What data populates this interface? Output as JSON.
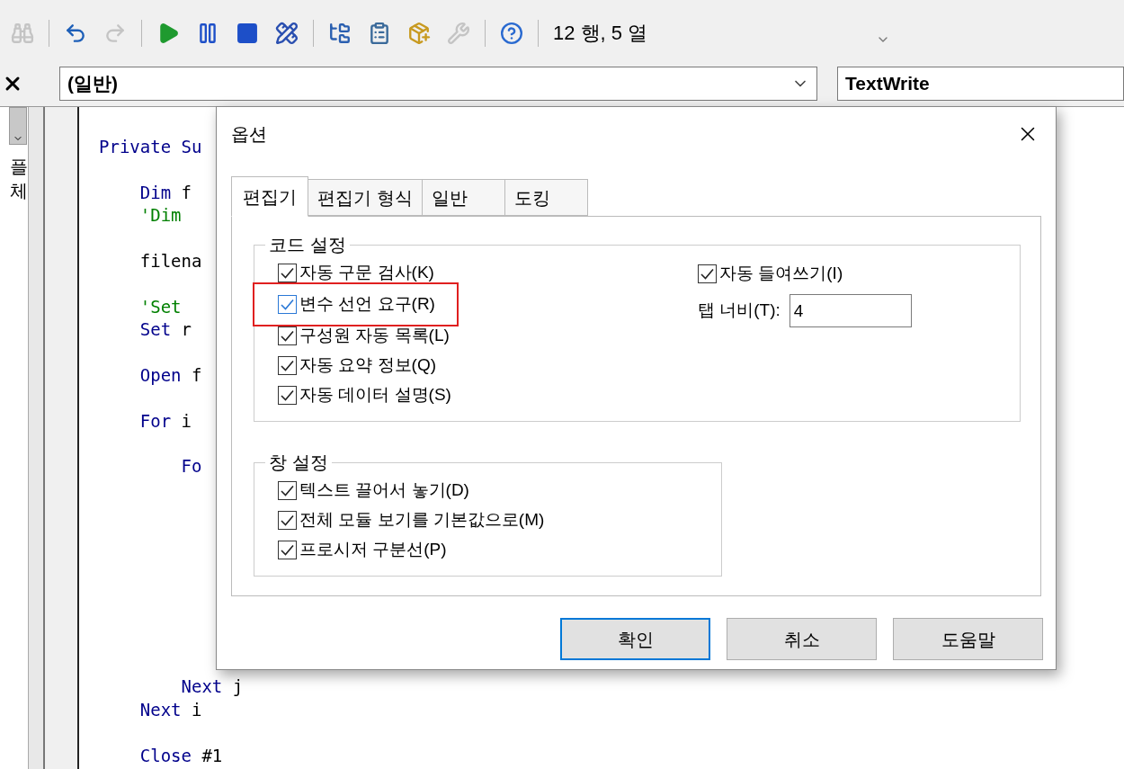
{
  "toolbar": {
    "buttons": [
      {
        "kind": "find",
        "disabled": true
      },
      {
        "kind": "separator"
      },
      {
        "kind": "undo",
        "disabled": false
      },
      {
        "kind": "redo",
        "disabled": true
      },
      {
        "kind": "separator"
      },
      {
        "kind": "run",
        "disabled": false
      },
      {
        "kind": "pause",
        "disabled": false
      },
      {
        "kind": "stop",
        "disabled": false
      },
      {
        "kind": "design",
        "disabled": false
      },
      {
        "kind": "separator"
      },
      {
        "kind": "project",
        "disabled": false
      },
      {
        "kind": "properties",
        "disabled": false
      },
      {
        "kind": "objects",
        "disabled": false
      },
      {
        "kind": "toolbox",
        "disabled": true
      },
      {
        "kind": "separator"
      },
      {
        "kind": "help",
        "disabled": false
      },
      {
        "kind": "separator"
      }
    ],
    "position": "12 행, 5 열"
  },
  "object_combo": {
    "value": "(일반)"
  },
  "procedure_combo": {
    "value": "TextWrite"
  },
  "left_panel": {
    "items": [
      "플",
      "체"
    ]
  },
  "code": {
    "top": [
      [
        {
          "tokens": [
            {
              "kind": "keyword",
              "text": "Private Su"
            }
          ]
        }
      ],
      [
        {
          "tokens": [
            {
              "kind": "keyword",
              "text": "    Dim"
            },
            {
              "kind": "plain",
              "text": " f"
            }
          ]
        },
        {
          "tokens": [
            {
              "kind": "comment",
              "text": "    'Dim"
            }
          ]
        }
      ],
      [
        {
          "tokens": [
            {
              "kind": "plain",
              "text": "    filena"
            }
          ]
        }
      ],
      [
        {
          "tokens": [
            {
              "kind": "comment",
              "text": "    'Set"
            }
          ]
        },
        {
          "tokens": [
            {
              "kind": "keyword",
              "text": "    Set"
            },
            {
              "kind": "plain",
              "text": " r"
            }
          ]
        }
      ],
      [
        {
          "tokens": [
            {
              "kind": "keyword",
              "text": "    Open"
            },
            {
              "kind": "plain",
              "text": " f"
            }
          ]
        }
      ],
      [
        {
          "tokens": [
            {
              "kind": "keyword",
              "text": "    For"
            },
            {
              "kind": "plain",
              "text": " i"
            }
          ]
        }
      ],
      [
        {
          "tokens": [
            {
              "kind": "keyword",
              "text": "        Fo"
            }
          ]
        }
      ]
    ],
    "bottom": [
      [
        {
          "tokens": [
            {
              "kind": "keyword",
              "text": "        Next"
            },
            {
              "kind": "plain",
              "text": " j"
            }
          ]
        },
        {
          "tokens": [
            {
              "kind": "keyword",
              "text": "    Next"
            },
            {
              "kind": "plain",
              "text": " i"
            }
          ]
        }
      ],
      [
        {
          "tokens": [
            {
              "kind": "keyword",
              "text": "    Close"
            },
            {
              "kind": "plain",
              "text": " #1"
            }
          ]
        }
      ]
    ]
  },
  "dialog": {
    "title": "옵션",
    "tabs": [
      {
        "label": "편집기",
        "selected": true
      },
      {
        "label": "편집기 형식",
        "selected": false
      },
      {
        "label": "일반",
        "selected": false
      },
      {
        "label": "도킹",
        "selected": false
      }
    ],
    "groups": [
      {
        "title": "코드 설정",
        "options": [
          {
            "label": "자동 구문 검사(K)",
            "checked": true,
            "highlighted": false
          },
          {
            "label": "변수 선언 요구(R)",
            "checked": true,
            "highlighted": true
          },
          {
            "label": "구성원 자동 목록(L)",
            "checked": true,
            "highlighted": false
          },
          {
            "label": "자동 요약 정보(Q)",
            "checked": true,
            "highlighted": false
          },
          {
            "label": "자동 데이터 설명(S)",
            "checked": true,
            "highlighted": false
          }
        ],
        "side_options": [
          {
            "kind": "checkbox",
            "label": "자동 들여쓰기(I)",
            "checked": true
          },
          {
            "kind": "field",
            "label": "탭 너비(T):",
            "value": "4"
          }
        ]
      },
      {
        "title": "창 설정",
        "options": [
          {
            "label": "텍스트 끌어서 놓기(D)",
            "checked": true,
            "highlighted": false
          },
          {
            "label": "전체 모듈 보기를 기본값으로(M)",
            "checked": true,
            "highlighted": false
          },
          {
            "label": "프로시저 구분선(P)",
            "checked": true,
            "highlighted": false
          }
        ]
      }
    ],
    "buttons": [
      {
        "label": "확인",
        "default": true
      },
      {
        "label": "취소",
        "default": false
      },
      {
        "label": "도움말",
        "default": false
      }
    ]
  }
}
